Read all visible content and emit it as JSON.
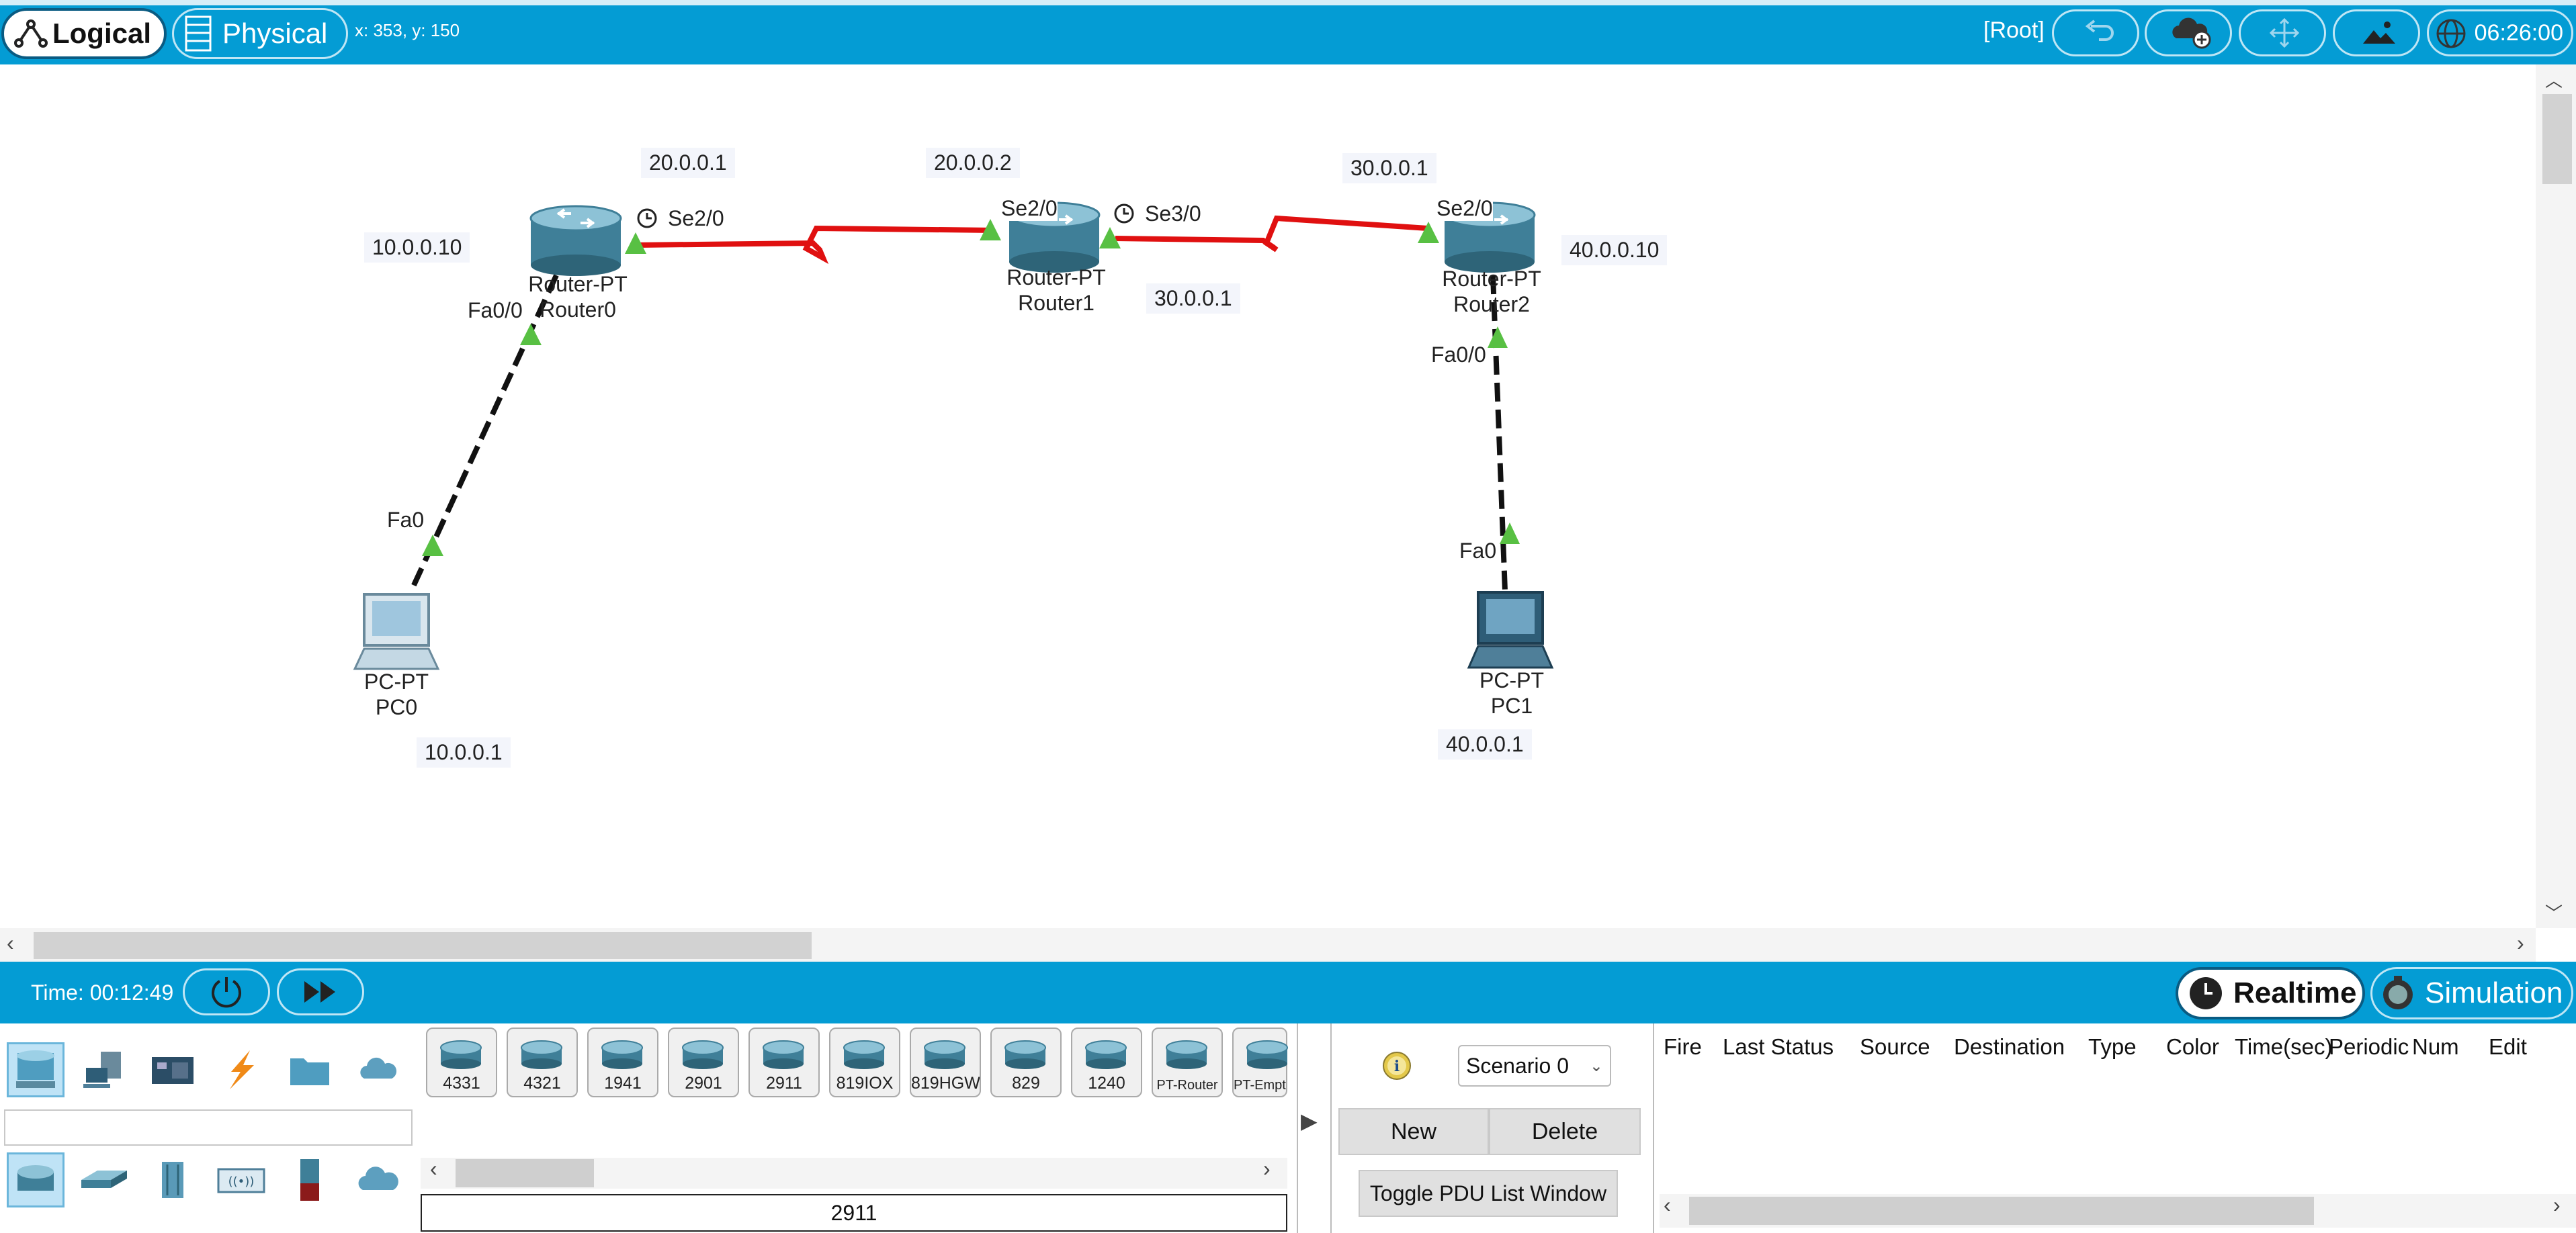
{
  "topbar": {
    "logical_label": "Logical",
    "physical_label": "Physical",
    "coords": "x: 353, y: 150",
    "root_label": "[Root]",
    "clock": "06:26:00"
  },
  "devices": {
    "router0": {
      "type": "Router-PT",
      "name": "Router0"
    },
    "router1": {
      "type": "Router-PT",
      "name": "Router1"
    },
    "router2": {
      "type": "Router-PT",
      "name": "Router2"
    },
    "pc0": {
      "type": "PC-PT",
      "name": "PC0"
    },
    "pc1": {
      "type": "PC-PT",
      "name": "PC1"
    }
  },
  "ports": {
    "r0_se": "Se2/0",
    "r0_fa": "Fa0/0",
    "pc0_fa": "Fa0",
    "r1_se2": "Se2/0",
    "r1_se3": "Se3/0",
    "r2_se": "Se2/0",
    "r2_fa": "Fa0/0",
    "pc1_fa": "Fa0"
  },
  "ips": {
    "r0_fa": "10.0.0.10",
    "r0_se": "20.0.0.1",
    "r1_se2": "20.0.0.2",
    "r1_se3": "30.0.0.1",
    "r2_se": "30.0.0.1",
    "r2_fa": "40.0.0.10",
    "pc0": "10.0.0.1",
    "pc1": "40.0.0.1"
  },
  "timebar": {
    "time": "Time: 00:12:49",
    "realtime_label": "Realtime",
    "simulation_label": "Simulation"
  },
  "device_models": [
    "4331",
    "4321",
    "1941",
    "2901",
    "2911",
    "819IOX",
    "819HGW",
    "829",
    "1240",
    "PT-Router",
    "PT-Empty"
  ],
  "selected_model": "2911",
  "scenario": {
    "selected": "Scenario 0",
    "new_label": "New",
    "delete_label": "Delete",
    "toggle_label": "Toggle PDU List Window"
  },
  "pdu_columns": [
    "Fire",
    "Last Status",
    "Source",
    "Destination",
    "Type",
    "Color",
    "Time(sec)",
    "Periodic",
    "Num",
    "Edit"
  ],
  "colors": {
    "accent": "#049cd4",
    "serial_link": "#e01010",
    "ethernet_link": "#111111",
    "port_up": "#58c043"
  }
}
